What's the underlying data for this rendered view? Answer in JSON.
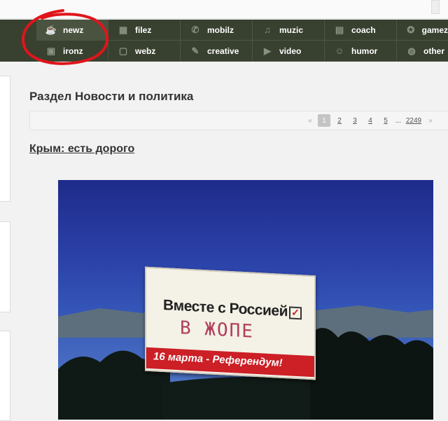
{
  "menu": {
    "row1": [
      {
        "label": "newz",
        "icon": "coffee-icon"
      },
      {
        "label": "filez",
        "icon": "film-icon"
      },
      {
        "label": "mobilz",
        "icon": "phone-icon"
      },
      {
        "label": "muzic",
        "icon": "headphones-icon"
      },
      {
        "label": "coach",
        "icon": "clipboard-icon"
      },
      {
        "label": "gamez",
        "icon": "gamepad-icon"
      }
    ],
    "row2": [
      {
        "label": "ironz",
        "icon": "server-icon"
      },
      {
        "label": "webz",
        "icon": "browser-icon"
      },
      {
        "label": "creative",
        "icon": "pencil-icon"
      },
      {
        "label": "video",
        "icon": "video-icon"
      },
      {
        "label": "humor",
        "icon": "smile-icon"
      },
      {
        "label": "other",
        "icon": "globe-icon"
      }
    ],
    "active": "newz"
  },
  "section": {
    "title": "Раздел Новости и политика"
  },
  "pagination": {
    "current": "1",
    "pages": [
      "1",
      "2",
      "3",
      "4",
      "5"
    ],
    "ellipsis": "...",
    "last": "2249"
  },
  "article": {
    "title": "Крым: есть дорого",
    "billboard": {
      "line1": "Вместе с Россией",
      "graffiti": "В ЖОПЕ",
      "date_line": "16 марта - Референдум!",
      "checkmark": "✓"
    }
  },
  "colors": {
    "menu_bg": "#38402f",
    "annotation": "#e0151b",
    "billboard_red": "#cc1f26"
  }
}
